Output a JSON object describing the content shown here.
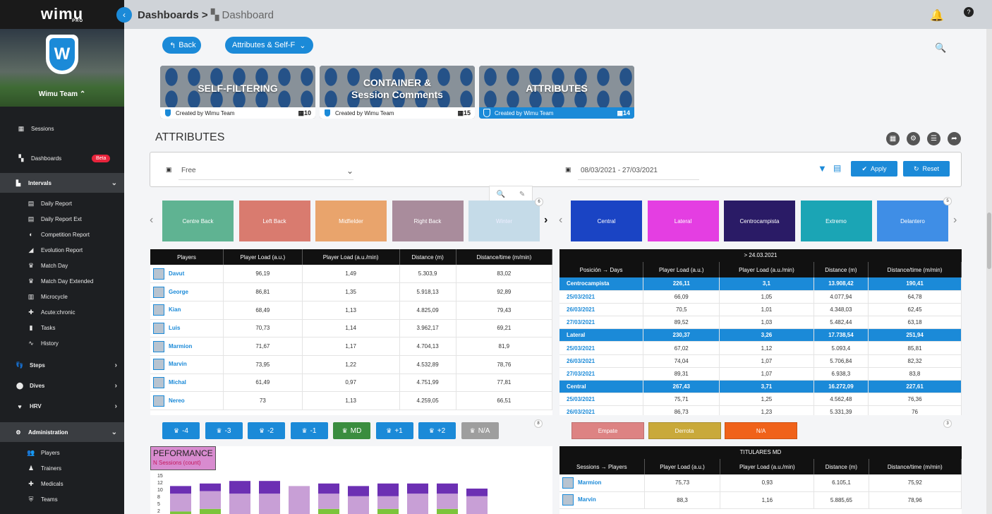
{
  "sidebar": {
    "logo": "wimu",
    "logo_sub": "PRO",
    "team_name": "Wimu Team ⌃",
    "items": [
      {
        "label": "Sessions",
        "icon": "sessions-icon",
        "glyph": "▦"
      },
      {
        "label": "Dashboards",
        "icon": "dashboard-icon",
        "glyph": "▚",
        "badge": "Beta"
      }
    ],
    "intervals_label": "Intervals",
    "interval_items": [
      {
        "label": "Daily Report",
        "glyph": "▤",
        "icon": "calendar-icon"
      },
      {
        "label": "Daily Report Ext",
        "glyph": "▤",
        "icon": "calendar-icon"
      },
      {
        "label": "Competition Report",
        "glyph": "◐",
        "icon": "competition-icon"
      },
      {
        "label": "Evolution Report",
        "glyph": "◢",
        "icon": "evolution-icon"
      },
      {
        "label": "Match Day",
        "glyph": "♛",
        "icon": "trophy-icon"
      },
      {
        "label": "Match Day Extended",
        "glyph": "♛",
        "icon": "trophy-icon"
      },
      {
        "label": "Microcycle",
        "glyph": "▥",
        "icon": "microcycle-icon"
      },
      {
        "label": "Acute:chronic",
        "glyph": "✚",
        "icon": "plus-icon"
      },
      {
        "label": "Tasks",
        "glyph": "▮",
        "icon": "clipboard-icon"
      },
      {
        "label": "History",
        "glyph": "∿",
        "icon": "history-icon"
      }
    ],
    "sections": [
      {
        "label": "Steps",
        "glyph": "👣",
        "icon": "steps-icon"
      },
      {
        "label": "Dives",
        "glyph": "⬤",
        "icon": "dives-icon"
      },
      {
        "label": "HRV",
        "glyph": "♥",
        "icon": "hrv-icon"
      }
    ],
    "admin_label": "Administration",
    "admin_items": [
      {
        "label": "Players",
        "glyph": "👥",
        "icon": "players-icon"
      },
      {
        "label": "Trainers",
        "glyph": "♟",
        "icon": "trainers-icon"
      },
      {
        "label": "Medicals",
        "glyph": "✚",
        "icon": "medicals-icon"
      },
      {
        "label": "Teams",
        "glyph": "⛨",
        "icon": "teams-icon"
      }
    ]
  },
  "header": {
    "crumb_root": "Dashboards",
    "crumb_sep": ">",
    "crumb_current": "Dashboard"
  },
  "toolbar": {
    "back_label": "Back",
    "dashboard_select": "Attributes & Self-F"
  },
  "cards": [
    {
      "title": "SELF-FILTERING",
      "subtitle": "",
      "created": "Created by Wimu Team",
      "count": "10",
      "selected": false
    },
    {
      "title": "CONTAINER &",
      "subtitle": "Session Comments",
      "created": "Created by Wimu Team",
      "count": "15",
      "selected": false
    },
    {
      "title": "ATTRIBUTES",
      "subtitle": "",
      "created": "Created by Wimu Team",
      "count": "14",
      "selected": true
    }
  ],
  "section_title": "ATTRIBUTES",
  "filter": {
    "period": "Free",
    "date_range": "08/03/2021 - 27/03/2021",
    "apply": "Apply",
    "reset": "Reset"
  },
  "positions_left": [
    {
      "label": "Centre Back",
      "color": "#5fb392"
    },
    {
      "label": "Left Back",
      "color": "#d97b6f"
    },
    {
      "label": "Midfielder",
      "color": "#e9a46c"
    },
    {
      "label": "Right Back",
      "color": "#a98c9c"
    },
    {
      "label": "Winter",
      "color": "#c5dbe8"
    }
  ],
  "positions_left_count": "6",
  "positions_right": [
    {
      "label": "Central",
      "color": "#1a44c4"
    },
    {
      "label": "Lateral",
      "color": "#e43ee2"
    },
    {
      "label": "Centrocampista",
      "color": "#2a1b66"
    },
    {
      "label": "Extremo",
      "color": "#1ba5b5"
    },
    {
      "label": "Delantero",
      "color": "#3f8ee6"
    }
  ],
  "positions_right_count": "5",
  "players_table": {
    "headers": [
      "Players",
      "Player Load (a.u.)",
      "Player Load (a.u./min)",
      "Distance (m)",
      "Distance/time (m/min)"
    ],
    "rows": [
      [
        "Davut",
        "96,19",
        "1,49",
        "5.303,9",
        "83,02"
      ],
      [
        "George",
        "86,81",
        "1,35",
        "5.918,13",
        "92,89"
      ],
      [
        "Kian",
        "68,49",
        "1,13",
        "4.825,09",
        "79,43"
      ],
      [
        "Luis",
        "70,73",
        "1,14",
        "3.962,17",
        "69,21"
      ],
      [
        "Marmion",
        "71,67",
        "1,17",
        "4.704,13",
        "81,9"
      ],
      [
        "Marvin",
        "73,95",
        "1,22",
        "4.532,89",
        "78,76"
      ],
      [
        "Michal",
        "61,49",
        "0,97",
        "4.751,99",
        "77,81"
      ],
      [
        "Nereo",
        "73",
        "1,13",
        "4.259,05",
        "66,51"
      ]
    ]
  },
  "days_table": {
    "caption": "> 24.03.2021",
    "headers": [
      "Posición → Days",
      "Player Load (a.u.)",
      "Player Load (a.u./min)",
      "Distance (m)",
      "Distance/time (m/min)"
    ],
    "rows": [
      {
        "g": true,
        "c": [
          "Centrocampista",
          "226,11",
          "3,1",
          "13.908,42",
          "190,41"
        ]
      },
      {
        "g": false,
        "c": [
          "25/03/2021",
          "66,09",
          "1,05",
          "4.077,94",
          "64,78"
        ]
      },
      {
        "g": false,
        "c": [
          "26/03/2021",
          "70,5",
          "1,01",
          "4.348,03",
          "62,45"
        ]
      },
      {
        "g": false,
        "c": [
          "27/03/2021",
          "89,52",
          "1,03",
          "5.482,44",
          "63,18"
        ]
      },
      {
        "g": true,
        "c": [
          "Lateral",
          "230,37",
          "3,26",
          "17.738,54",
          "251,94"
        ]
      },
      {
        "g": false,
        "c": [
          "25/03/2021",
          "67,02",
          "1,12",
          "5.093,4",
          "85,81"
        ]
      },
      {
        "g": false,
        "c": [
          "26/03/2021",
          "74,04",
          "1,07",
          "5.706,84",
          "82,32"
        ]
      },
      {
        "g": false,
        "c": [
          "27/03/2021",
          "89,31",
          "1,07",
          "6.938,3",
          "83,8"
        ]
      },
      {
        "g": true,
        "c": [
          "Central",
          "267,43",
          "3,71",
          "16.272,09",
          "227,61"
        ]
      },
      {
        "g": false,
        "c": [
          "25/03/2021",
          "75,71",
          "1,25",
          "4.562,48",
          "76,36"
        ]
      },
      {
        "g": false,
        "c": [
          "26/03/2021",
          "86,73",
          "1,23",
          "5.331,39",
          "76"
        ]
      }
    ]
  },
  "md_buttons": [
    {
      "label": "-4",
      "color": "#1b8ad8"
    },
    {
      "label": "-3",
      "color": "#1b8ad8"
    },
    {
      "label": "-2",
      "color": "#1b8ad8"
    },
    {
      "label": "-1",
      "color": "#1b8ad8"
    },
    {
      "label": "MD",
      "color": "#3a8d3f"
    },
    {
      "label": "+1",
      "color": "#1b8ad8"
    },
    {
      "label": "+2",
      "color": "#1b8ad8"
    },
    {
      "label": "N/A",
      "color": "#9e9e9e"
    }
  ],
  "md_count": "8",
  "results": [
    {
      "label": "Empate",
      "color": "#dd8383"
    },
    {
      "label": "Derrota",
      "color": "#c9a93a"
    },
    {
      "label": "N/A",
      "color": "#f0621a"
    }
  ],
  "results_count": "3",
  "performance": {
    "title": "PEFORMANCE",
    "subtitle": "N Sessions (count)",
    "y_ticks": [
      "15",
      "12",
      "10",
      "8",
      "5",
      "2"
    ]
  },
  "chart_data": {
    "type": "bar",
    "title": "PEFORMANCE",
    "subtitle": "N Sessions (count)",
    "ylim": [
      0,
      15
    ],
    "series": [
      {
        "values": [
          11,
          12,
          13,
          13,
          11,
          12,
          11,
          12,
          12,
          12,
          10
        ],
        "color": "#c89fd6"
      },
      {
        "values": [
          3,
          3,
          5,
          5,
          0,
          4,
          4,
          5,
          4,
          4,
          3
        ],
        "color": "#6c2fb3"
      },
      {
        "values": [
          1,
          2,
          0,
          0,
          0,
          2,
          0,
          2,
          0,
          2,
          0
        ],
        "color": "#7cc43b"
      }
    ]
  },
  "titulares": {
    "caption": "TITULARES MD",
    "headers": [
      "Sessions → Players",
      "Player Load (a.u.)",
      "Player Load (a.u./min)",
      "Distance (m)",
      "Distance/time (m/min)"
    ],
    "rows": [
      [
        "Marmion",
        "75,73",
        "0,93",
        "6.105,1",
        "75,92"
      ],
      [
        "Marvin",
        "88,3",
        "1,16",
        "5.885,65",
        "78,96"
      ]
    ]
  }
}
